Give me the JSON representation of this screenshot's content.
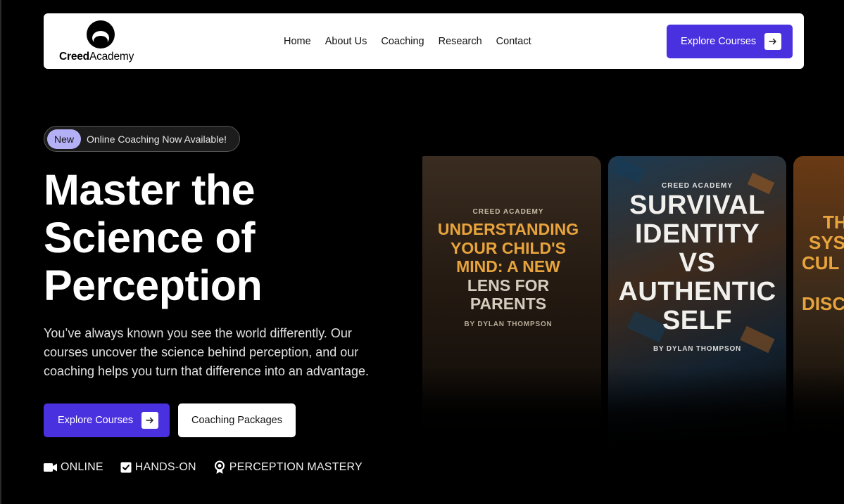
{
  "nav": {
    "logo_bold": "Creed",
    "logo_regular": "Academy",
    "links": [
      "Home",
      "About Us",
      "Coaching",
      "Research",
      "Contact"
    ],
    "cta_label": "Explore Courses"
  },
  "hero": {
    "badge_label": "New",
    "badge_text": "Online Coaching Now Available!",
    "title": "Master the Science of Perception",
    "description": "You’ve always known you see the world differently. Our courses uncover the science behind perception, and our coaching helps you turn that difference into an advantage.",
    "primary_cta": "Explore Courses",
    "secondary_cta": "Coaching Packages",
    "features": [
      {
        "icon": "video-camera-icon",
        "label": "ONLINE"
      },
      {
        "icon": "checkbox-icon",
        "label": "HANDS-ON"
      },
      {
        "icon": "award-ribbon-icon",
        "label": "PERCEPTION MASTERY"
      }
    ]
  },
  "books": [
    {
      "publisher": "CREED ACADEMY",
      "title_lines": [
        "UNDERSTANDING",
        "YOUR CHILD'S",
        "MIND: A NEW",
        "LENS FOR",
        "PARENTS"
      ],
      "author": "BY DYLAN THOMPSON"
    },
    {
      "publisher": "CREED ACADEMY",
      "title_lines": [
        "SURVIVAL",
        "IDENTITY",
        "VS",
        "AUTHENTIC",
        "SELF"
      ],
      "author": "BY DYLAN THOMPSON"
    },
    {
      "title_lines": [
        "TH",
        "SYS",
        "CUL",
        "",
        "DISC"
      ]
    }
  ],
  "colors": {
    "accent": "#4a31e0",
    "badge": "#b3b0f5",
    "book_orange": "#e8a43c"
  }
}
